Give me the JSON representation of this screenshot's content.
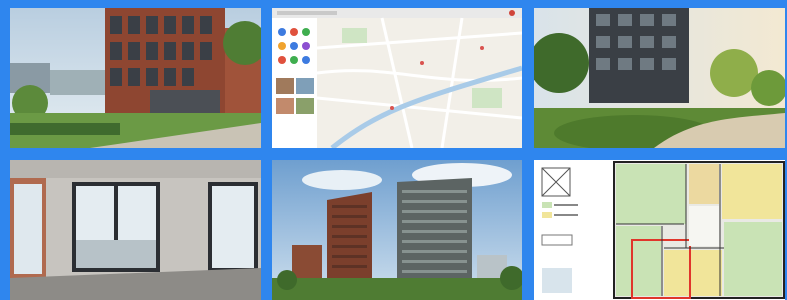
{
  "gallery": {
    "background_color": "#2f86ee",
    "tiles": [
      {
        "id": 1,
        "subject": "courtyard-exterior-photo"
      },
      {
        "id": 2,
        "subject": "map-screenshot"
      },
      {
        "id": 3,
        "subject": "garden-courtyard-photo"
      },
      {
        "id": 4,
        "subject": "empty-interior-photo"
      },
      {
        "id": 5,
        "subject": "residential-towers-render"
      },
      {
        "id": 6,
        "subject": "floor-plan"
      }
    ]
  }
}
